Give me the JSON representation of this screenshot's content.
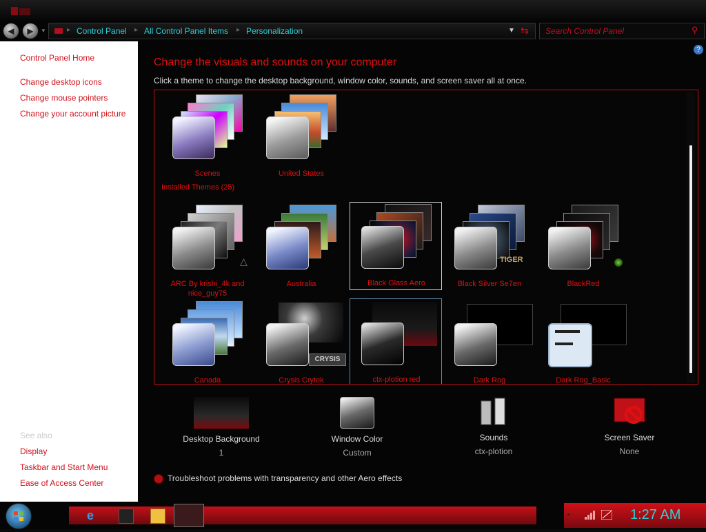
{
  "window": {
    "icon": "control-panel-icon"
  },
  "address": {
    "crumbs": [
      "Control Panel",
      "All Control Panel Items",
      "Personalization"
    ],
    "search_placeholder": "Search Control Panel"
  },
  "sidebar": {
    "home": "Control Panel Home",
    "links": [
      "Change desktop icons",
      "Change mouse pointers",
      "Change your account picture"
    ],
    "see_also": "See also",
    "see_also_links": [
      "Display",
      "Taskbar and Start Menu",
      "Ease of Access Center"
    ]
  },
  "main": {
    "heading": "Change the visuals and sounds on your computer",
    "subheading": "Click a theme to change the desktop background, window color, sounds, and screen saver all at once.",
    "group_label": "Installed Themes (25)",
    "themes_top": [
      "Scenes",
      "United States"
    ],
    "themes_installed": [
      "ARC By krishi_4k and nice_guy75",
      "Australia",
      "Black Glass Aero",
      "Black Silver Se7en",
      "BlackRed"
    ],
    "themes_row3": [
      "Canada",
      "Crysis Crytek",
      "ctx-plotion red",
      "Dark Rog",
      "Dark Rog_Basic"
    ],
    "thumb_text_tiger": "TIGER",
    "thumb_text_crysis": "CRYSIS"
  },
  "tools": [
    {
      "label": "Desktop Background",
      "value": "1",
      "icon": "desktop-background-icon"
    },
    {
      "label": "Window Color",
      "value": "Custom",
      "icon": "window-color-icon"
    },
    {
      "label": "Sounds",
      "value": "ctx-plotion",
      "icon": "sounds-icon"
    },
    {
      "label": "Screen Saver",
      "value": "None",
      "icon": "screen-saver-icon"
    }
  ],
  "troubleshoot": "Troubleshoot problems with transparency and other Aero effects",
  "taskbar": {
    "clock": "1:27 AM"
  },
  "colors": {
    "accent_red": "#e01010",
    "cyan_text": "#2fd0d8"
  }
}
